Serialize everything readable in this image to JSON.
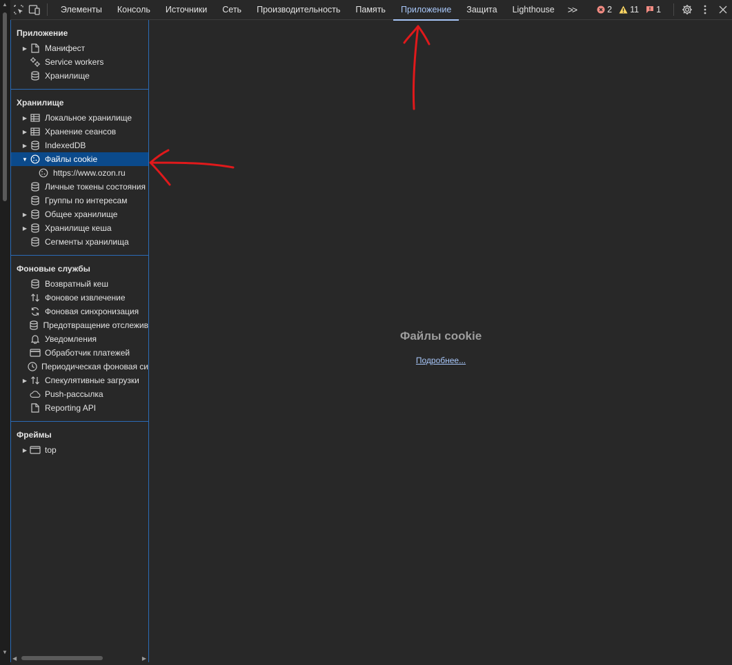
{
  "toolbar": {
    "tabs": [
      "Элементы",
      "Консоль",
      "Источники",
      "Сеть",
      "Производительность",
      "Память",
      "Приложение",
      "Защита",
      "Lighthouse"
    ],
    "active_tab": "Приложение",
    "more_label": ">>",
    "errors": "2",
    "warnings": "11",
    "issues": "1"
  },
  "sidebar": {
    "app_section": {
      "title": "Приложение",
      "items": [
        "Манифест",
        "Service workers",
        "Хранилище"
      ]
    },
    "storage_section": {
      "title": "Хранилище",
      "items": [
        "Локальное хранилище",
        "Хранение сеансов",
        "IndexedDB",
        "Файлы cookie",
        "https://www.ozon.ru",
        "Личные токены состояния",
        "Группы по интересам",
        "Общее хранилище",
        "Хранилище кеша",
        "Сегменты хранилища"
      ]
    },
    "background_section": {
      "title": "Фоновые службы",
      "items": [
        "Возвратный кеш",
        "Фоновое извлечение",
        "Фоновая синхронизация",
        "Предотвращение отслежив",
        "Уведомления",
        "Обработчик платежей",
        "Периодическая фоновая си",
        "Спекулятивные загрузки",
        "Push-рассылка",
        "Reporting API"
      ]
    },
    "frames_section": {
      "title": "Фреймы",
      "items": [
        "top"
      ]
    }
  },
  "main": {
    "title": "Файлы cookie",
    "learn_more": "Подробнее..."
  },
  "colors": {
    "accent": "#a8c7fa",
    "selected_bg": "#0b4a8b",
    "annotation": "#e0191b"
  }
}
